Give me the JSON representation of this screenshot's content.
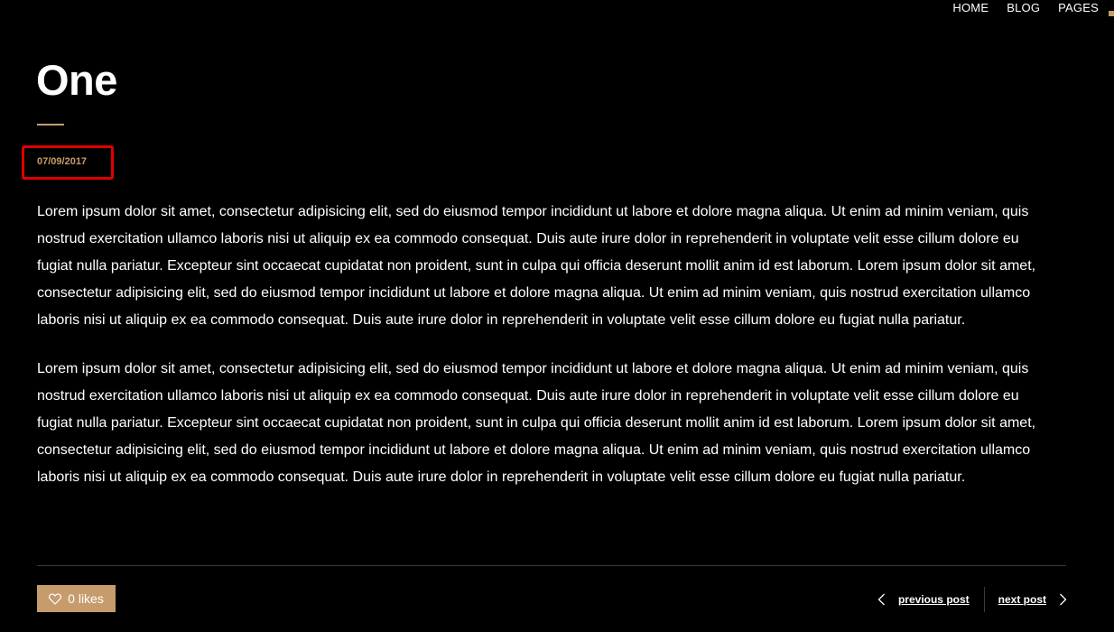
{
  "nav": {
    "items": [
      {
        "label": "HOME"
      },
      {
        "label": "BLOG"
      },
      {
        "label": "PAGES"
      }
    ]
  },
  "post": {
    "title": "One",
    "date": "07/09/2017",
    "paragraphs": [
      "Lorem ipsum dolor sit amet, consectetur adipisicing elit, sed do eiusmod tempor incididunt ut labore et dolore magna aliqua. Ut enim ad minim veniam, quis nostrud exercitation ullamco laboris nisi ut aliquip ex ea commodo consequat. Duis aute irure dolor in reprehenderit in voluptate velit esse cillum dolore eu fugiat nulla pariatur. Excepteur sint occaecat cupidatat non proident, sunt in culpa qui officia deserunt mollit anim id est laborum. Lorem ipsum dolor sit amet, consectetur adipisicing elit, sed do eiusmod tempor incididunt ut labore et dolore magna aliqua. Ut enim ad minim veniam, quis nostrud exercitation ullamco laboris nisi ut aliquip ex ea commodo consequat. Duis aute irure dolor in reprehenderit in voluptate velit esse cillum dolore eu fugiat nulla pariatur.",
      "Lorem ipsum dolor sit amet, consectetur adipisicing elit, sed do eiusmod tempor incididunt ut labore et dolore magna aliqua. Ut enim ad minim veniam, quis nostrud exercitation ullamco laboris nisi ut aliquip ex ea commodo consequat. Duis aute irure dolor in reprehenderit in voluptate velit esse cillum dolore eu fugiat nulla pariatur. Excepteur sint occaecat cupidatat non proident, sunt in culpa qui officia deserunt mollit anim id est laborum. Lorem ipsum dolor sit amet, consectetur adipisicing elit, sed do eiusmod tempor incididunt ut labore et dolore magna aliqua. Ut enim ad minim veniam, quis nostrud exercitation ullamco laboris nisi ut aliquip ex ea commodo consequat. Duis aute irure dolor in reprehenderit in voluptate velit esse cillum dolore eu fugiat nulla pariatur."
    ]
  },
  "footer": {
    "likes_label": "0 likes",
    "likes_icon": "heart-icon",
    "previous_label": "previous post",
    "next_label": "next post"
  },
  "colors": {
    "background": "#000000",
    "text": "#ffffff",
    "accent": "#c69c6d",
    "highlight_box": "#e00000",
    "divider": "#3a3a3a"
  }
}
